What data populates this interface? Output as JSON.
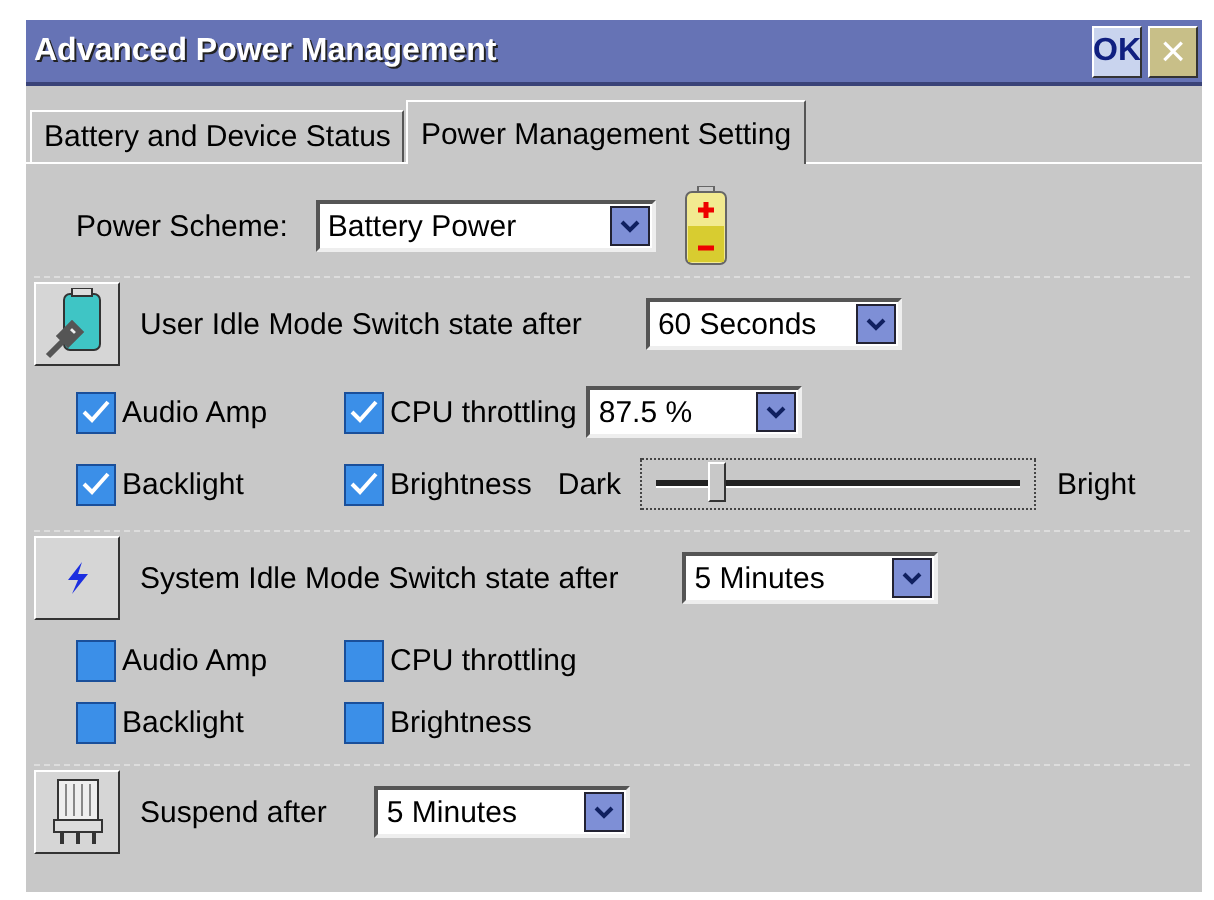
{
  "window": {
    "title": "Advanced Power Management",
    "buttons": [
      {
        "kind": "ok",
        "label": "OK"
      },
      {
        "kind": "close",
        "label": "×"
      }
    ]
  },
  "tabs": [
    {
      "label": "Battery and Device Status",
      "selected": false
    },
    {
      "label": "Power Management Setting",
      "selected": true
    }
  ],
  "power_scheme": {
    "label": "Power Scheme:",
    "value": "Battery Power"
  },
  "sections": [
    {
      "label": "User Idle Mode Switch state after",
      "value": "60 Seconds",
      "options": [
        {
          "label": "Audio Amp",
          "checked": true
        },
        {
          "label": "CPU throttling",
          "checked": true,
          "value": "87.5 %"
        },
        {
          "label": "Backlight",
          "checked": true
        },
        {
          "label": "Brightness",
          "checked": true,
          "slider": {
            "min_label": "Dark",
            "max_label": "Bright",
            "level": 0.17
          }
        }
      ]
    },
    {
      "label": "System Idle Mode Switch state after",
      "value": "5 Minutes",
      "options": [
        {
          "label": "Audio Amp",
          "checked": false
        },
        {
          "label": "CPU throttling",
          "checked": false
        },
        {
          "label": "Backlight",
          "checked": false
        },
        {
          "label": "Brightness",
          "checked": false
        }
      ]
    },
    {
      "label": "Suspend after",
      "value": "5 Minutes"
    }
  ]
}
